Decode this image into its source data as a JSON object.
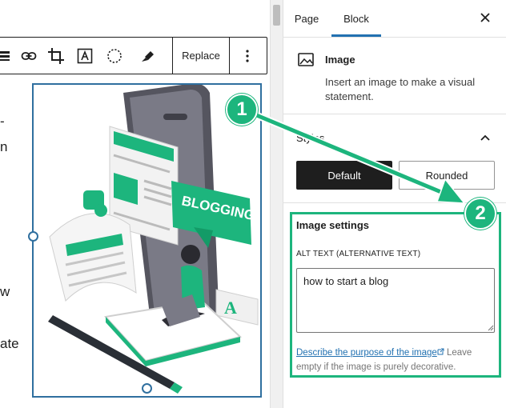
{
  "editor": {
    "toolbar": {
      "replace_label": "Replace",
      "more_icon": "more-vertical-icon",
      "icons": [
        "align-icon",
        "link-icon",
        "crop-icon",
        "text-overlay-icon",
        "select-circle-icon",
        "highlighter-icon"
      ]
    },
    "paragraph_fragments": [
      "-",
      "n",
      "w",
      "ate"
    ],
    "image_illustration_text": "BLOGGING"
  },
  "sidebar": {
    "tabs": [
      {
        "label": "Page",
        "active": false
      },
      {
        "label": "Block",
        "active": true
      }
    ],
    "close_icon": "close-icon",
    "block_card": {
      "icon": "image-icon",
      "title": "Image",
      "description": "Insert an image to make a visual statement."
    },
    "styles": {
      "title": "Styles",
      "options": [
        {
          "label": "Default",
          "selected": true
        },
        {
          "label": "Rounded",
          "selected": false
        }
      ]
    },
    "image_settings": {
      "title": "Image settings",
      "alt_label": "ALT TEXT (ALTERNATIVE TEXT)",
      "alt_value": "how to start a blog",
      "help_link": "Describe the purpose of the image",
      "help_text": "Leave empty if the image is purely decorative."
    }
  },
  "annotations": {
    "badge_1": "1",
    "badge_2": "2",
    "color": "#1db57d"
  },
  "colors": {
    "accent": "#2271b1",
    "selection": "#2f6f9f",
    "highlight": "#1db57d"
  }
}
